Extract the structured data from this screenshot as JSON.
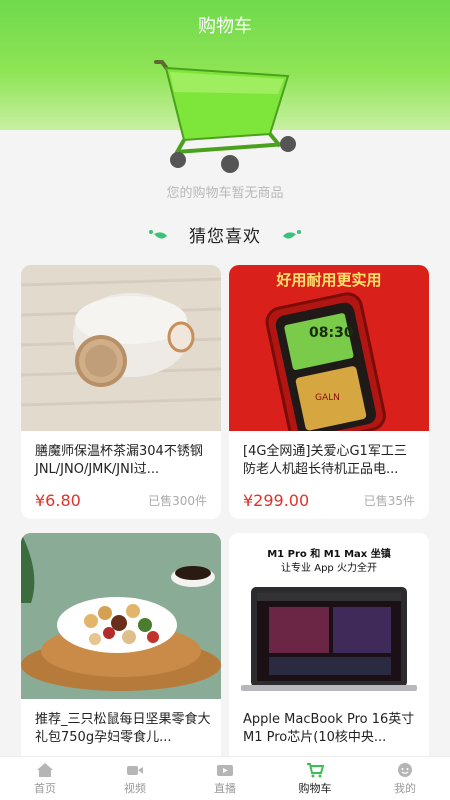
{
  "header": {
    "title": "购物车"
  },
  "empty_message": "您的购物车暂无商品",
  "recommend": {
    "title": "猜您喜欢"
  },
  "products": [
    {
      "name": "膳魔师保温杯茶漏304不锈钢JNL/JNO/JMK/JNI过...",
      "price": "¥6.80",
      "sold": "已售300件"
    },
    {
      "name": "[4G全网通]关爱心G1军工三防老人机超长待机正品电...",
      "price": "¥299.00",
      "sold": "已售35件",
      "banner": "好用耐用更实用",
      "phone_screen": "08:30",
      "phone_brand": "GALN"
    },
    {
      "name": "推荐_三只松鼠每日坚果零食大礼包750g孕妇零食儿...",
      "price": "",
      "sold": ""
    },
    {
      "name": "Apple MacBook Pro 16英寸 M1 Pro芯片(10核中央...",
      "price": "",
      "sold": "",
      "ad_line1": "M1 Pro 和 M1 Max 坐镇",
      "ad_line2": "让专业 App 火力全开"
    }
  ],
  "tabbar": [
    {
      "label": "首页",
      "icon": "home-icon"
    },
    {
      "label": "视频",
      "icon": "video-icon"
    },
    {
      "label": "直播",
      "icon": "live-icon"
    },
    {
      "label": "购物车",
      "icon": "cart-icon",
      "active": true
    },
    {
      "label": "我的",
      "icon": "profile-icon"
    }
  ],
  "colors": {
    "accent": "#7ddc4a",
    "price": "#e0322b",
    "tab_active": "#3bbf55"
  }
}
